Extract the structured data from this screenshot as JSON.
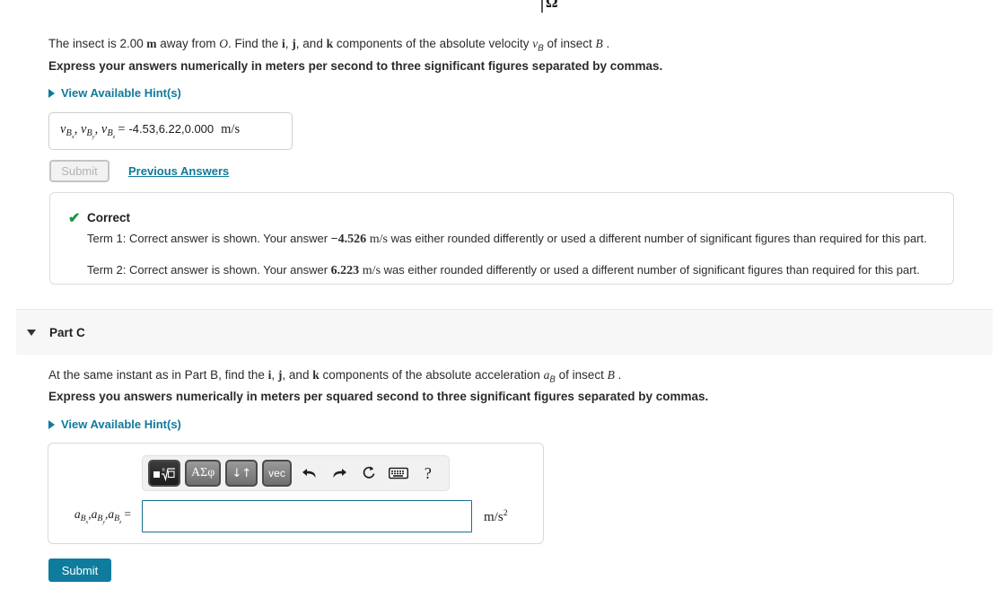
{
  "figure": {
    "omega_label": "Ω",
    "axis_icon": "rotation-axis",
    "arc_color": "#56b4d9"
  },
  "colors": {
    "link": "#0f7a9c",
    "submit": "#0f7c9e",
    "correct": "#1a9641",
    "input_border": "#16708e",
    "part_header_bg": "#f7f7f7"
  },
  "part_b": {
    "question_pre": "The insect is ",
    "question_num": "2.00",
    "question_unit": "m",
    "question_mid": " away from ",
    "question_point": "O",
    "question_find": ". Find the ",
    "vec_i": "i",
    "vec_j": "j",
    "vec_k": "k",
    "question_mid2": " components of the absolute velocity ",
    "quantity": "v",
    "quantity_sub": "B",
    "question_tail": " of insect ",
    "insect": "B",
    "question_end": " .",
    "instruction": "Express your answers numerically in meters per second to three significant figures separated by commas.",
    "hint_label": "View Available Hint(s)",
    "answer_label_var": "v",
    "answer_label_sub_base": "B",
    "answer_label_subs": [
      "x",
      "y",
      "z"
    ],
    "answer_equals": "=",
    "answer_value": "-4.53,6.22,0.000",
    "answer_unit": "m/s",
    "submit_label": "Submit",
    "previous_answers_label": "Previous Answers"
  },
  "feedback": {
    "status_icon": "check-icon",
    "status": "Correct",
    "lines": [
      {
        "prefix": "Term 1: Correct answer is shown. Your answer ",
        "value": "−4.526",
        "unit": "m/s",
        "suffix": " was either rounded differently or used a different number of significant figures than required for this part."
      },
      {
        "prefix": "Term 2: Correct answer is shown. Your answer ",
        "value": "6.223",
        "unit": "m/s",
        "suffix": " was either rounded differently or used a different number of significant figures than required for this part."
      }
    ]
  },
  "part_c": {
    "header_label": "Part C",
    "collapse_icon": "chevron-down-icon",
    "question_pre": "At the same instant as in Part B, find the ",
    "vec_i": "i",
    "vec_j": "j",
    "vec_k": "k",
    "question_mid": " components of the absolute acceleration ",
    "quantity": "a",
    "quantity_sub": "B",
    "question_tail": " of insect ",
    "insect": "B",
    "question_end": " .",
    "instruction": "Express you answers numerically in meters per squared second to three significant figures separated by commas.",
    "hint_label": "View Available Hint(s)",
    "answer_label_var": "a",
    "answer_label_sub_base": "B",
    "answer_label_subs": [
      "x",
      "y",
      "z"
    ],
    "answer_equals": "=",
    "answer_value": "",
    "answer_placeholder": "",
    "answer_unit_base": "m/s",
    "answer_unit_exp": "2",
    "submit_label": "Submit",
    "toolbar": {
      "buttons": [
        {
          "name": "template-root-button",
          "label": "√"
        },
        {
          "name": "greek-symbols-button",
          "label": "ΑΣφ"
        },
        {
          "name": "updown-arrows-button",
          "label": "↓↑"
        },
        {
          "name": "vector-button",
          "label": "vec"
        }
      ],
      "icons": [
        {
          "name": "undo-icon",
          "label": "↩"
        },
        {
          "name": "redo-icon",
          "label": "↪"
        },
        {
          "name": "reset-icon",
          "label": "↻"
        },
        {
          "name": "keyboard-icon",
          "label": "⌨"
        },
        {
          "name": "help-icon",
          "label": "?"
        }
      ]
    }
  }
}
